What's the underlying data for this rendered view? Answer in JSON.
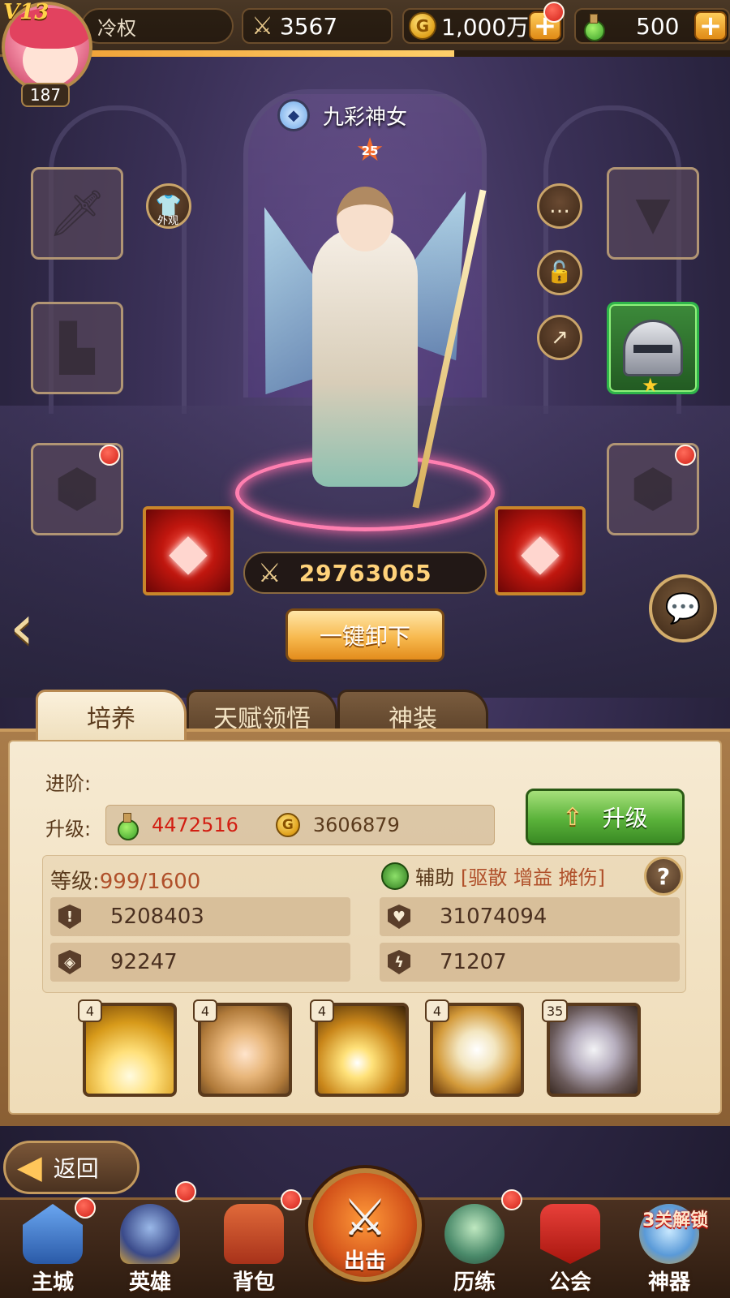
{
  "player": {
    "vip": "V13",
    "level": "187",
    "name": "冷权",
    "power": "3567",
    "gold": "1,000万",
    "potions": "500",
    "xp_progress": 0.57
  },
  "hero": {
    "name": "九彩神女",
    "star_level": "25",
    "skin_label": "外观",
    "combat_power": "29763065",
    "unequip_label": "一键卸下"
  },
  "tabs": [
    "培养",
    "天赋领悟",
    "神装"
  ],
  "panel": {
    "advance_label": "进阶:",
    "upgrade_label": "升级:",
    "cost_potions": "4472516",
    "cost_gold": "3606879",
    "upgrade_button": "升级",
    "level_label": "等级:",
    "level_value": "999/1600",
    "role": "辅助",
    "role_tags": "[驱散 增益 摊伤]",
    "help": "?",
    "stats": {
      "attack": "5208403",
      "hp": "31074094",
      "defense": "92247",
      "speed": "71207"
    },
    "skills": [
      {
        "level": "4",
        "name": "skill-1"
      },
      {
        "level": "4",
        "name": "skill-2"
      },
      {
        "level": "4",
        "name": "skill-3"
      },
      {
        "level": "4",
        "name": "skill-4"
      },
      {
        "level": "35",
        "name": "skill-5"
      }
    ]
  },
  "nav": {
    "return": "返回",
    "items": [
      "主城",
      "英雄",
      "背包",
      "出击",
      "历练",
      "公会",
      "神器"
    ],
    "unlock_tag": "3关解锁"
  },
  "colors": {
    "accent_gold": "#f7b94e",
    "upgrade_green": "#5ab23a",
    "cost_red": "#d21e12",
    "aura_pink": "#ff7fb0"
  }
}
